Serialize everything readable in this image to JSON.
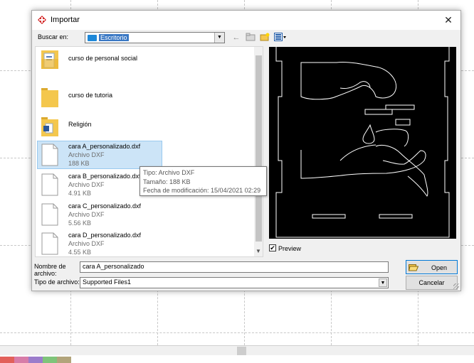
{
  "dialog": {
    "title": "Importar",
    "look_in_label": "Buscar en:",
    "look_in_value": "Escritorio",
    "nav_icons": [
      "back-icon",
      "up-folder-icon",
      "new-folder-icon",
      "view-menu-icon"
    ],
    "close_icon": "close-icon"
  },
  "files": [
    {
      "kind": "folder",
      "name": "curso de personal social",
      "icon": "folder-icon"
    },
    {
      "kind": "folder",
      "name": "curso de tutoria",
      "icon": "folder-icon"
    },
    {
      "kind": "folder",
      "name": "Religión",
      "icon": "folder-icon"
    },
    {
      "kind": "file",
      "name": "cara A_personalizado.dxf",
      "type": "Archivo DXF",
      "size": "188 KB",
      "selected": true
    },
    {
      "kind": "file",
      "name": "cara B_personalizado.dxf",
      "type": "Archivo DXF",
      "size": "4.91 KB"
    },
    {
      "kind": "file",
      "name": "cara C_personalizado.dxf",
      "type": "Archivo DXF",
      "size": "5.56 KB"
    },
    {
      "kind": "file",
      "name": "cara D_personalizado.dxf",
      "type": "Archivo DXF",
      "size": "4.55 KB"
    }
  ],
  "tooltip": {
    "line1": "Tipo: Archivo DXF",
    "line2": "Tamaño: 188 KB",
    "line3": "Fecha de modificación: 15/04/2021 02:29"
  },
  "preview": {
    "label": "Preview",
    "checked": true
  },
  "filename": {
    "label": "Nombre de archivo:",
    "value": "cara A_personalizado"
  },
  "filetype": {
    "label": "Tipo de archivo:",
    "value": "Supported Files1"
  },
  "buttons": {
    "open": "Open",
    "cancel": "Cancelar"
  },
  "colors": {
    "selection": "#cce4f7",
    "accent": "#0078d7",
    "folder": "#f4c74d",
    "preview_bg": "#000000"
  }
}
